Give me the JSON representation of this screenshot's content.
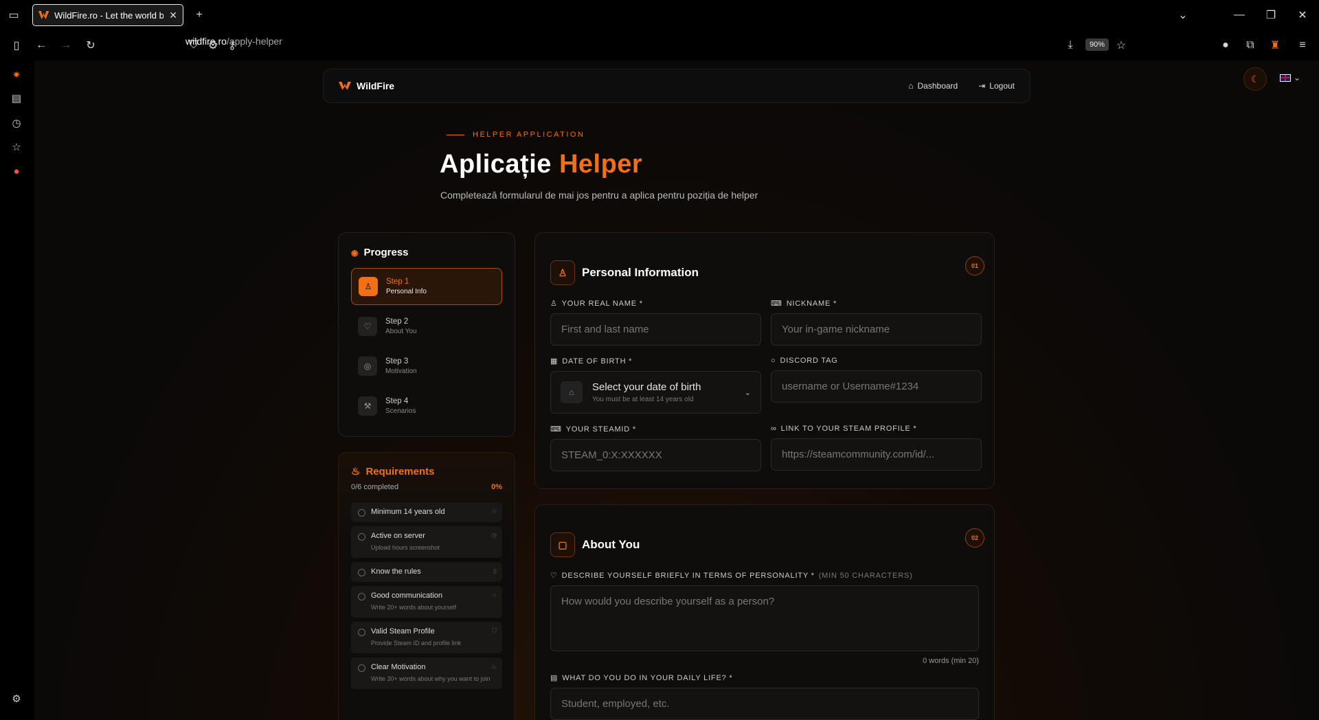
{
  "browser": {
    "tab_title": "WildFire.ro - Let the world burn",
    "url_host": "wildfire.ro",
    "url_path": "/apply-helper",
    "zoom": "90%"
  },
  "site": {
    "logo": "WildFire",
    "nav": {
      "dashboard": "Dashboard",
      "logout": "Logout"
    }
  },
  "hero": {
    "eyebrow": "HELPER APPLICATION",
    "title_main": "Aplicație",
    "title_accent": "Helper",
    "subtitle": "Completează formularul de mai jos pentru a aplica pentru poziția de helper"
  },
  "progress": {
    "title": "Progress",
    "steps": [
      {
        "step": "Step 1",
        "label": "Personal Info"
      },
      {
        "step": "Step 2",
        "label": "About You"
      },
      {
        "step": "Step 3",
        "label": "Motivation"
      },
      {
        "step": "Step 4",
        "label": "Scenarios"
      }
    ]
  },
  "requirements": {
    "title": "Requirements",
    "completed": "0/6 completed",
    "percent": "0%",
    "items": [
      {
        "label": "Minimum 14 years old",
        "sub": ""
      },
      {
        "label": "Active on server",
        "sub": "Upload hours screenshot"
      },
      {
        "label": "Know the rules",
        "sub": ""
      },
      {
        "label": "Good communication",
        "sub": "Write 20+ words about yourself"
      },
      {
        "label": "Valid Steam Profile",
        "sub": "Provide Steam ID and profile link"
      },
      {
        "label": "Clear Motivation",
        "sub": "Write 30+ words about why you want to join"
      }
    ]
  },
  "personal": {
    "title": "Personal Information",
    "num": "01",
    "real_name_label": "YOUR REAL NAME *",
    "real_name_ph": "First and last name",
    "nickname_label": "NICKNAME *",
    "nickname_ph": "Your in-game nickname",
    "dob_label": "DATE OF BIRTH *",
    "dob_value": "Select your date of birth",
    "dob_hint": "You must be at least 14 years old",
    "discord_label": "DISCORD TAG",
    "discord_ph": "username or Username#1234",
    "steamid_label": "YOUR STEAMID *",
    "steamid_ph": "STEAM_0:X:XXXXXX",
    "steamlink_label": "LINK TO YOUR STEAM PROFILE *",
    "steamlink_ph": "https://steamcommunity.com/id/..."
  },
  "about": {
    "title": "About You",
    "num": "02",
    "personality_label": "DESCRIBE YOURSELF BRIEFLY IN TERMS OF PERSONALITY *",
    "personality_hint": "(MIN 50 CHARACTERS)",
    "personality_ph": "How would you describe yourself as a person?",
    "word_count": "0 words (min 20)",
    "daily_label": "WHAT DO YOU DO IN YOUR DAILY LIFE? *",
    "daily_ph": "Student, employed, etc."
  }
}
